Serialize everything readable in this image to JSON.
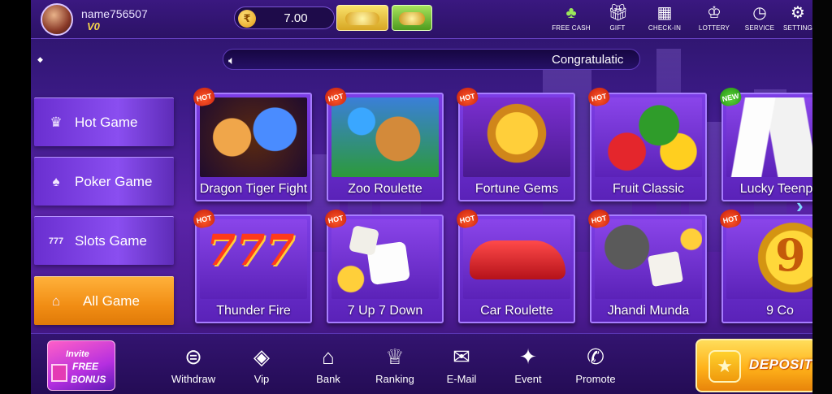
{
  "header": {
    "username": "name756507",
    "vip_level": "V0",
    "balance": "7.00",
    "coin_icon": "rupee-coin-icon",
    "top_menu": [
      {
        "label": "FREE CASH",
        "icon": "free-cash-icon"
      },
      {
        "label": "GIFT",
        "icon": "gift-icon"
      },
      {
        "label": "CHECK-IN",
        "icon": "check-in-icon"
      },
      {
        "label": "LOTTERY",
        "icon": "lottery-icon"
      },
      {
        "label": "SERVICE",
        "icon": "service-icon"
      },
      {
        "label": "SETTING",
        "icon": "setting-icon"
      }
    ]
  },
  "marquee": {
    "icon": "speaker-icon",
    "text": "Congratulatic"
  },
  "categories": [
    {
      "label": "Hot Game",
      "icon": "crown-icon",
      "active": false
    },
    {
      "label": "Poker Game",
      "icon": "poker-chip-icon",
      "active": false
    },
    {
      "label": "Slots Game",
      "icon": "slots-777-icon",
      "active": false
    },
    {
      "label": "All Game",
      "icon": "home-icon",
      "active": true
    }
  ],
  "games": [
    {
      "title": "Dragon Tiger Fight",
      "tag": "HOT"
    },
    {
      "title": "Zoo Roulette",
      "tag": "HOT"
    },
    {
      "title": "Fortune Gems",
      "tag": "HOT"
    },
    {
      "title": "Fruit Classic",
      "tag": "HOT"
    },
    {
      "title": "Lucky Teenpa",
      "tag": "NEW"
    },
    {
      "title": "Thunder Fire",
      "tag": "HOT"
    },
    {
      "title": "7 Up 7 Down",
      "tag": "HOT"
    },
    {
      "title": "Car Roulette",
      "tag": "HOT"
    },
    {
      "title": "Jhandi Munda",
      "tag": "HOT"
    },
    {
      "title": "9 Co",
      "tag": "HOT"
    }
  ],
  "bottom_nav": {
    "invite": {
      "line1": "Invite",
      "line2": "FREE",
      "line3": "BONUS"
    },
    "items": [
      {
        "label": "Withdraw",
        "icon": "withdraw-icon"
      },
      {
        "label": "Vip",
        "icon": "vip-diamond-icon"
      },
      {
        "label": "Bank",
        "icon": "bank-icon"
      },
      {
        "label": "Ranking",
        "icon": "ranking-trophy-icon"
      },
      {
        "label": "E-Mail",
        "icon": "email-icon"
      },
      {
        "label": "Event",
        "icon": "event-star-icon"
      },
      {
        "label": "Promote",
        "icon": "promote-icon"
      }
    ],
    "deposit_label": "DEPOSIT"
  },
  "colors": {
    "background": "#4a1c99",
    "card": "#6b30d4",
    "active_category": "#f6951a",
    "deposit": "#ffb21a"
  }
}
